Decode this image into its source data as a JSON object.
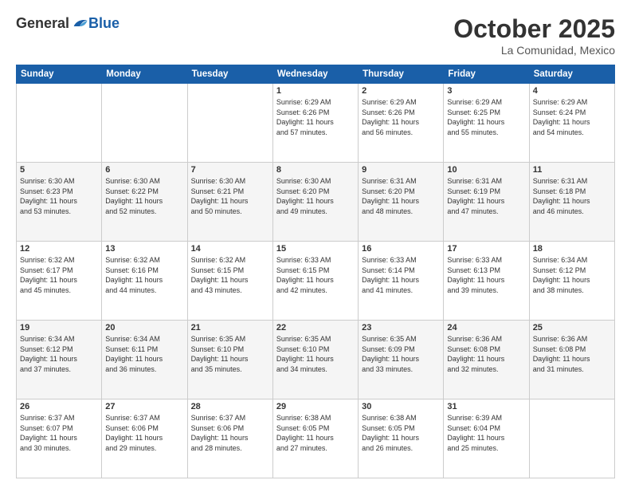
{
  "header": {
    "logo_general": "General",
    "logo_blue": "Blue",
    "month": "October 2025",
    "location": "La Comunidad, Mexico"
  },
  "weekdays": [
    "Sunday",
    "Monday",
    "Tuesday",
    "Wednesday",
    "Thursday",
    "Friday",
    "Saturday"
  ],
  "weeks": [
    [
      {
        "day": "",
        "info": ""
      },
      {
        "day": "",
        "info": ""
      },
      {
        "day": "",
        "info": ""
      },
      {
        "day": "1",
        "info": "Sunrise: 6:29 AM\nSunset: 6:26 PM\nDaylight: 11 hours\nand 57 minutes."
      },
      {
        "day": "2",
        "info": "Sunrise: 6:29 AM\nSunset: 6:26 PM\nDaylight: 11 hours\nand 56 minutes."
      },
      {
        "day": "3",
        "info": "Sunrise: 6:29 AM\nSunset: 6:25 PM\nDaylight: 11 hours\nand 55 minutes."
      },
      {
        "day": "4",
        "info": "Sunrise: 6:29 AM\nSunset: 6:24 PM\nDaylight: 11 hours\nand 54 minutes."
      }
    ],
    [
      {
        "day": "5",
        "info": "Sunrise: 6:30 AM\nSunset: 6:23 PM\nDaylight: 11 hours\nand 53 minutes."
      },
      {
        "day": "6",
        "info": "Sunrise: 6:30 AM\nSunset: 6:22 PM\nDaylight: 11 hours\nand 52 minutes."
      },
      {
        "day": "7",
        "info": "Sunrise: 6:30 AM\nSunset: 6:21 PM\nDaylight: 11 hours\nand 50 minutes."
      },
      {
        "day": "8",
        "info": "Sunrise: 6:30 AM\nSunset: 6:20 PM\nDaylight: 11 hours\nand 49 minutes."
      },
      {
        "day": "9",
        "info": "Sunrise: 6:31 AM\nSunset: 6:20 PM\nDaylight: 11 hours\nand 48 minutes."
      },
      {
        "day": "10",
        "info": "Sunrise: 6:31 AM\nSunset: 6:19 PM\nDaylight: 11 hours\nand 47 minutes."
      },
      {
        "day": "11",
        "info": "Sunrise: 6:31 AM\nSunset: 6:18 PM\nDaylight: 11 hours\nand 46 minutes."
      }
    ],
    [
      {
        "day": "12",
        "info": "Sunrise: 6:32 AM\nSunset: 6:17 PM\nDaylight: 11 hours\nand 45 minutes."
      },
      {
        "day": "13",
        "info": "Sunrise: 6:32 AM\nSunset: 6:16 PM\nDaylight: 11 hours\nand 44 minutes."
      },
      {
        "day": "14",
        "info": "Sunrise: 6:32 AM\nSunset: 6:15 PM\nDaylight: 11 hours\nand 43 minutes."
      },
      {
        "day": "15",
        "info": "Sunrise: 6:33 AM\nSunset: 6:15 PM\nDaylight: 11 hours\nand 42 minutes."
      },
      {
        "day": "16",
        "info": "Sunrise: 6:33 AM\nSunset: 6:14 PM\nDaylight: 11 hours\nand 41 minutes."
      },
      {
        "day": "17",
        "info": "Sunrise: 6:33 AM\nSunset: 6:13 PM\nDaylight: 11 hours\nand 39 minutes."
      },
      {
        "day": "18",
        "info": "Sunrise: 6:34 AM\nSunset: 6:12 PM\nDaylight: 11 hours\nand 38 minutes."
      }
    ],
    [
      {
        "day": "19",
        "info": "Sunrise: 6:34 AM\nSunset: 6:12 PM\nDaylight: 11 hours\nand 37 minutes."
      },
      {
        "day": "20",
        "info": "Sunrise: 6:34 AM\nSunset: 6:11 PM\nDaylight: 11 hours\nand 36 minutes."
      },
      {
        "day": "21",
        "info": "Sunrise: 6:35 AM\nSunset: 6:10 PM\nDaylight: 11 hours\nand 35 minutes."
      },
      {
        "day": "22",
        "info": "Sunrise: 6:35 AM\nSunset: 6:10 PM\nDaylight: 11 hours\nand 34 minutes."
      },
      {
        "day": "23",
        "info": "Sunrise: 6:35 AM\nSunset: 6:09 PM\nDaylight: 11 hours\nand 33 minutes."
      },
      {
        "day": "24",
        "info": "Sunrise: 6:36 AM\nSunset: 6:08 PM\nDaylight: 11 hours\nand 32 minutes."
      },
      {
        "day": "25",
        "info": "Sunrise: 6:36 AM\nSunset: 6:08 PM\nDaylight: 11 hours\nand 31 minutes."
      }
    ],
    [
      {
        "day": "26",
        "info": "Sunrise: 6:37 AM\nSunset: 6:07 PM\nDaylight: 11 hours\nand 30 minutes."
      },
      {
        "day": "27",
        "info": "Sunrise: 6:37 AM\nSunset: 6:06 PM\nDaylight: 11 hours\nand 29 minutes."
      },
      {
        "day": "28",
        "info": "Sunrise: 6:37 AM\nSunset: 6:06 PM\nDaylight: 11 hours\nand 28 minutes."
      },
      {
        "day": "29",
        "info": "Sunrise: 6:38 AM\nSunset: 6:05 PM\nDaylight: 11 hours\nand 27 minutes."
      },
      {
        "day": "30",
        "info": "Sunrise: 6:38 AM\nSunset: 6:05 PM\nDaylight: 11 hours\nand 26 minutes."
      },
      {
        "day": "31",
        "info": "Sunrise: 6:39 AM\nSunset: 6:04 PM\nDaylight: 11 hours\nand 25 minutes."
      },
      {
        "day": "",
        "info": ""
      }
    ]
  ]
}
